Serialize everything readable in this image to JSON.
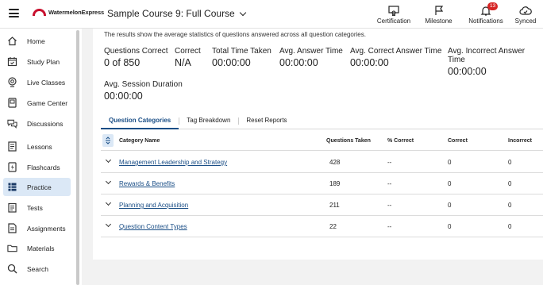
{
  "header": {
    "logo_text": "WatermelonExpress",
    "course": "Sample Course 9: Full Course",
    "actions": [
      {
        "label": "Certification",
        "icon": "certificate-icon"
      },
      {
        "label": "Milestone",
        "icon": "milestone-icon"
      },
      {
        "label": "Notifications",
        "icon": "bell-icon",
        "badge": "13"
      },
      {
        "label": "Synced",
        "icon": "cloud-sync-icon"
      }
    ]
  },
  "sidebar": {
    "items": [
      {
        "label": "Home",
        "icon": "home-icon"
      },
      {
        "label": "Study Plan",
        "icon": "calendar-icon"
      },
      {
        "label": "Live Classes",
        "icon": "live-classes-icon"
      },
      {
        "label": "Game Center",
        "icon": "game-center-icon"
      },
      {
        "label": "Discussions",
        "icon": "discussions-icon"
      },
      {
        "label": "Lessons",
        "icon": "lessons-icon"
      },
      {
        "label": "Flashcards",
        "icon": "flashcards-icon"
      },
      {
        "label": "Practice",
        "icon": "practice-icon",
        "active": true
      },
      {
        "label": "Tests",
        "icon": "tests-icon"
      },
      {
        "label": "Assignments",
        "icon": "assignments-icon"
      },
      {
        "label": "Materials",
        "icon": "materials-icon"
      },
      {
        "label": "Search",
        "icon": "search-icon"
      }
    ]
  },
  "main": {
    "intro": "The results show the average statistics of questions answered across all question categories.",
    "stats": [
      {
        "label": "Questions Correct",
        "value": "0 of 850"
      },
      {
        "label": "Correct",
        "value": "N/A"
      },
      {
        "label": "Total Time Taken",
        "value": "00:00:00"
      },
      {
        "label": "Avg. Answer Time",
        "value": "00:00:00"
      },
      {
        "label": "Avg. Correct Answer Time",
        "value": "00:00:00"
      },
      {
        "label": "Avg. Incorrect Answer Time",
        "value": "00:00:00"
      },
      {
        "label": "Avg. Session Duration",
        "value": "00:00:00"
      }
    ],
    "tabs": [
      "Question Categories",
      "Tag Breakdown",
      "Reset Reports"
    ],
    "table": {
      "headers": [
        "Category Name",
        "Questions Taken",
        "% Correct",
        "Correct",
        "Incorrect"
      ],
      "rows": [
        {
          "name": "Management Leadership and Strategy",
          "taken": "428",
          "pct": "--",
          "correct": "0",
          "incorrect": "0"
        },
        {
          "name": "Rewards & Benefits",
          "taken": "189",
          "pct": "--",
          "correct": "0",
          "incorrect": "0"
        },
        {
          "name": "Planning and Acquisition",
          "taken": "211",
          "pct": "--",
          "correct": "0",
          "incorrect": "0"
        },
        {
          "name": "Question Content Types",
          "taken": "22",
          "pct": "--",
          "correct": "0",
          "incorrect": "0"
        }
      ]
    }
  },
  "colors": {
    "brand": "#c8102e",
    "link": "#1a4e86",
    "active_nav": "#dbe8f6",
    "badge": "#d62424"
  }
}
